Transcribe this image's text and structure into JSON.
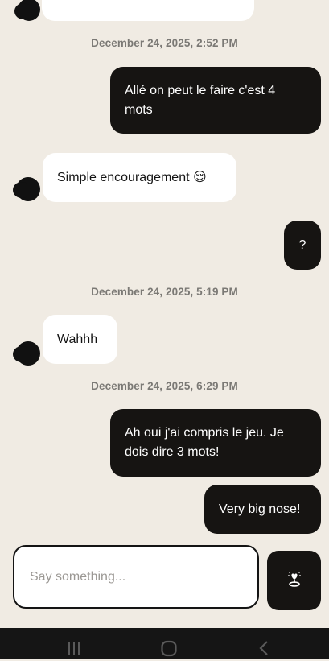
{
  "messages": [
    {
      "kind": "timestamp",
      "text": "December 24, 2025, 2:52 PM"
    },
    {
      "kind": "outgoing",
      "text": "Allé on peut le faire c'est 4 mots"
    },
    {
      "kind": "incoming",
      "text": "Simple encouragement 😌"
    },
    {
      "kind": "outgoing",
      "text": "?"
    },
    {
      "kind": "timestamp",
      "text": "December 24, 2025, 5:19 PM"
    },
    {
      "kind": "incoming",
      "text": "Wahhh"
    },
    {
      "kind": "timestamp",
      "text": "December 24, 2025, 6:29 PM"
    },
    {
      "kind": "outgoing",
      "text": "Ah oui j'ai compris le jeu. Je dois dire 3 mots!"
    },
    {
      "kind": "outgoing",
      "text": "Very big nose!"
    }
  ],
  "composer": {
    "placeholder": "Say something...",
    "value": "",
    "action_icon": "date-idea-icon"
  },
  "navbar": {
    "icons": [
      "recent-apps-icon",
      "home-icon",
      "back-icon"
    ]
  },
  "colors": {
    "background": "#f0ebe3",
    "outgoing_bubble": "#161412",
    "incoming_bubble": "#ffffff",
    "timestamp_text": "#7b7975",
    "navbar": "#151515"
  }
}
